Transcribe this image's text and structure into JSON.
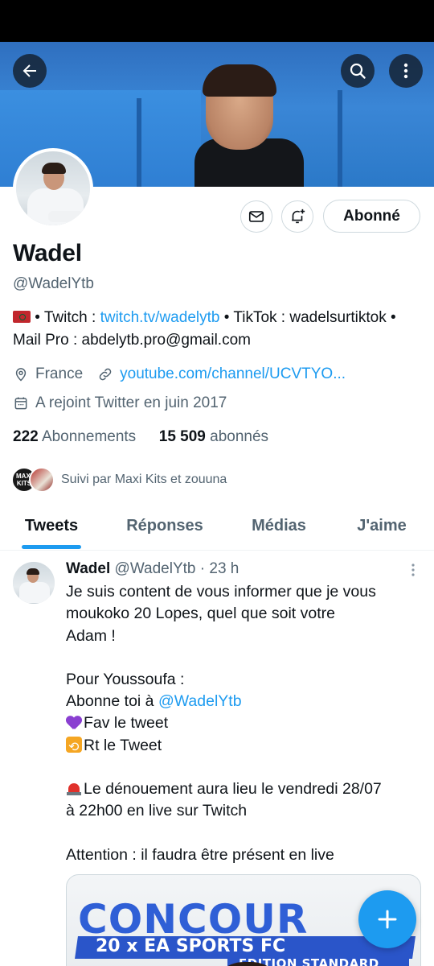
{
  "profile": {
    "name": "Wadel",
    "handle": "@WadelYtb",
    "follow_button": "Abonné",
    "bio": {
      "flag": "flag-morocco",
      "part1": " • Twitch : ",
      "twitch_link": "twitch.tv/wadelytb",
      "part2": " • TikTok : wadelsurtiktok • Mail Pro : abdelytb.pro@gmail.com"
    },
    "location": "France",
    "website": "youtube.com/channel/UCVTYO...",
    "joined": "A rejoint Twitter en juin 2017",
    "following_count": "222",
    "following_label": "Abonnements",
    "followers_count": "15 509",
    "followers_label": "abonnés",
    "followed_by": "Suivi par Maxi Kits et zouuna",
    "followed_by_avatar1_text": "MAXI KITS"
  },
  "tabs": [
    "Tweets",
    "Réponses",
    "Médias",
    "J'aime"
  ],
  "tweet": {
    "name": "Wadel",
    "handle": "@WadelYtb",
    "time": "· 23 h",
    "lines": {
      "l1": "Je suis content de vous informer que je vous",
      "l2": "moukoko 20 Lopes, quel que soit votre",
      "l3": "Adam !",
      "l5": "Pour Youssoufa :",
      "l6a": "Abonne toi à ",
      "l6b": "@WadelYtb",
      "l7": "Fav le tweet",
      "l8": "Rt le Tweet",
      "l10": "Le dénouement aura lieu le vendredi 28/07",
      "l11": "à 22h00 en live sur Twitch",
      "l13": "Attention : il faudra être présent en live"
    },
    "media": {
      "title": "CONCOUR",
      "band": "20 x EA SPORTS FC",
      "sub": "EDITION STANDARD"
    }
  },
  "colors": {
    "accent": "#1d9bf0",
    "text": "#0f1419",
    "secondary": "#536471"
  }
}
